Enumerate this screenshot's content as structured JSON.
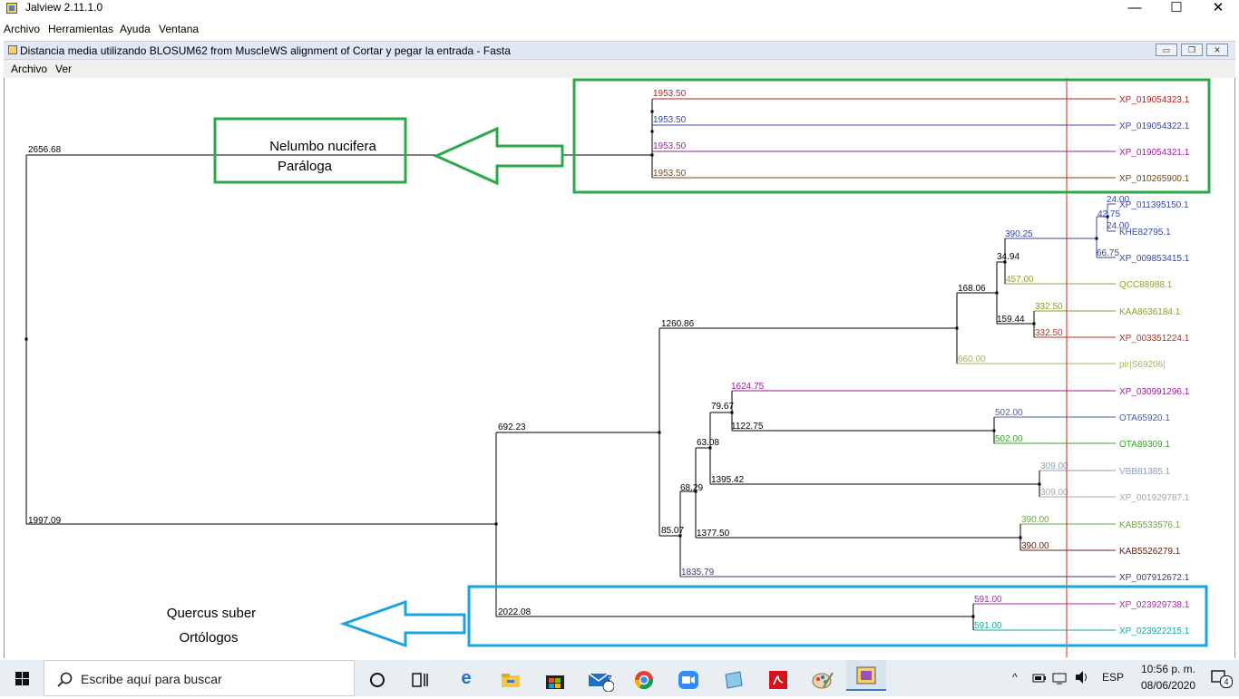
{
  "app": {
    "title": "Jalview 2.11.1.0",
    "menu": [
      "Archivo",
      "Herramientas",
      "Ayuda",
      "Ventana"
    ],
    "controls": {
      "minimize": "—",
      "maximize": "☐",
      "close": "✕"
    }
  },
  "tree_window": {
    "title": "Distancia media utilizando BLOSUM62 from MuscleWS alignment of Cortar y pegar la entrada - Fasta",
    "menu": [
      "Archivo",
      "Ver"
    ]
  },
  "tree": {
    "node_labels": [
      "2656.68",
      "1997.09",
      "1953.50",
      "1953.50",
      "1953.50",
      "1953.50",
      "24.00",
      "42.75",
      "24.00",
      "66.75",
      "390.25",
      "34.94",
      "457.00",
      "168.06",
      "332.50",
      "159.44",
      "332.50",
      "1260.86",
      "660.00",
      "1624.75",
      "79.67",
      "1122.75",
      "502.00",
      "502.00",
      "63.08",
      "309.00",
      "1395.42",
      "309.00",
      "68.29",
      "85.07",
      "1377.50",
      "390.00",
      "390.00",
      "692.23",
      "1835.79",
      "591.00",
      "2022.08",
      "591.00"
    ],
    "leaves": [
      {
        "name": "XP_019054323.1",
        "color": "#b22222"
      },
      {
        "name": "XP_019054322.1",
        "color": "#3548a8"
      },
      {
        "name": "XP_019054321.1",
        "color": "#9a1f9a"
      },
      {
        "name": "XP_010265900.1",
        "color": "#7a4410"
      },
      {
        "name": "XP_011395150.1",
        "color": "#3548a8"
      },
      {
        "name": "KHE82795.1",
        "color": "#3548a8"
      },
      {
        "name": "XP_009853415.1",
        "color": "#3548a8"
      },
      {
        "name": "QCC88988.1",
        "color": "#9aa030"
      },
      {
        "name": "KAA8636184.1",
        "color": "#86a030"
      },
      {
        "name": "XP_003351224.1",
        "color": "#b83020"
      },
      {
        "name": "pir|S69206|",
        "color": "#a8b068"
      },
      {
        "name": "XP_030991296.1",
        "color": "#9a1f9a"
      },
      {
        "name": "OTA65920.1",
        "color": "#4560b0"
      },
      {
        "name": "OTA89309.1",
        "color": "#38a028"
      },
      {
        "name": "VBB81385.1",
        "color": "#8aa0b8"
      },
      {
        "name": "XP_001929787.1",
        "color": "#a8a8a8"
      },
      {
        "name": "KAB5533576.1",
        "color": "#68a838"
      },
      {
        "name": "KAB5526279.1",
        "color": "#5a2418"
      },
      {
        "name": "XP_007912672.1",
        "color": "#3a3a6a"
      },
      {
        "name": "XP_023929738.1",
        "color": "#a828a8"
      },
      {
        "name": "XP_023922215.1",
        "color": "#18a8a0"
      }
    ]
  },
  "annotations": {
    "nelumbo_line1": "Nelumbo nucifera",
    "nelumbo_line2": "Paráloga",
    "quercus_line1": "Quercus suber",
    "quercus_line2": "Ortólogos",
    "green": "#2ca84a",
    "blue": "#1aa3e0"
  },
  "taskbar": {
    "search_placeholder": "Escribe aquí para buscar",
    "mail_badge": "7",
    "language": "ESP",
    "time": "10:56 p. m.",
    "date": "08/06/2020",
    "notification_count": "4"
  }
}
